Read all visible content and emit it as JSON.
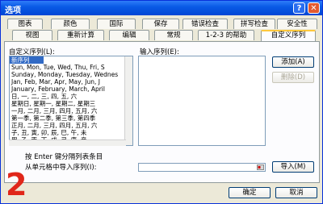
{
  "window": {
    "title": "选项",
    "help_glyph": "?",
    "close_glyph": "✕"
  },
  "tabs_row1": [
    "图表",
    "颜色",
    "国际",
    "保存",
    "错误检查",
    "拼写检查",
    "安全性"
  ],
  "tabs_row2": [
    "视图",
    "重新计算",
    "编辑",
    "常规",
    "1-2-3 的帮助",
    "自定义序列"
  ],
  "active_tab": "自定义序列",
  "custom_lists": {
    "label": "自定义序列(L):",
    "items": [
      "新序列",
      "Sun, Mon, Tue, Wed, Thu, Fri, S",
      "Sunday, Monday, Tuesday, Wednes",
      "Jan, Feb, Mar, Apr, May, Jun, J",
      "January, February, March, April",
      "日, 一, 二, 三, 四, 五, 六",
      "星期日, 星期一, 星期二, 星期三",
      "一月, 二月, 三月, 四月, 五月, 六",
      "第一季, 第二季, 第三季, 第四季",
      "正月, 二月, 三月, 四月, 五月, 六",
      "子, 丑, 寅, 卯, 辰, 巳, 午, 未",
      "甲, 乙, 丙, 丁, 戊, 己, 庚, 辛"
    ],
    "selected_index": 0
  },
  "entries": {
    "label": "输入序列(E):",
    "value": ""
  },
  "buttons": {
    "add": "添加(A)",
    "delete": "删除(D)",
    "import": "导入(M)",
    "ok": "确定",
    "cancel": "取消"
  },
  "hint": "按 Enter 键分隔列表条目",
  "import_label": "从单元格中导入序列(I):",
  "import_value": "",
  "annotation": "2",
  "colors": {
    "title_bar": "#0046d5",
    "selection": "#316ac5",
    "annotation": "#e0271a"
  }
}
